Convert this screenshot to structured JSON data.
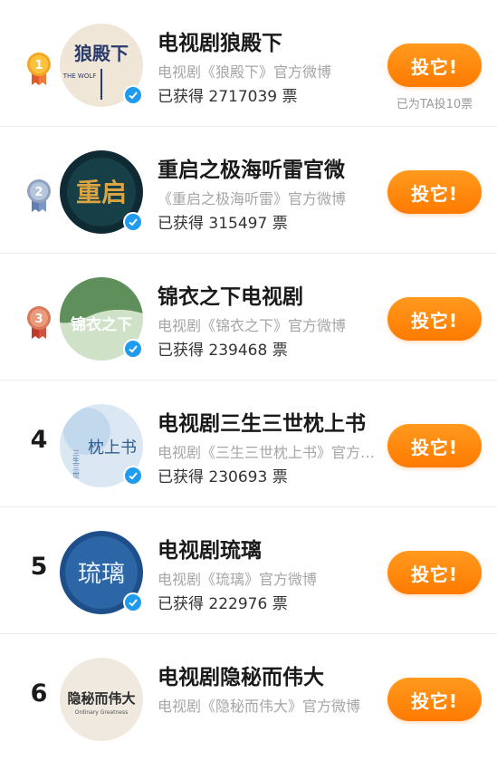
{
  "button_label": "投它!",
  "colors": {
    "accent": "#ff8a00",
    "verified": "#1f9bf0",
    "gold": "#f5a623",
    "silver": "#8fa3c0",
    "bronze": "#d9785a"
  },
  "items": [
    {
      "rank": "1",
      "medal": "gold",
      "name": "电视剧狼殿下",
      "desc": "电视剧《狼殿下》官方微博",
      "votes": "已获得 2717039 票",
      "voted_note": "已为TA投10票",
      "avatar_text": "狼殿下",
      "avatar_sub": "THE WOLF"
    },
    {
      "rank": "2",
      "medal": "silver",
      "name": "重启之极海听雷官微",
      "desc": "《重启之极海听雷》官方微博",
      "votes": "已获得 315497 票",
      "avatar_text": "重启"
    },
    {
      "rank": "3",
      "medal": "bronze",
      "name": "锦衣之下电视剧",
      "desc": "电视剧《锦衣之下》官方微博",
      "votes": "已获得 239468 票",
      "avatar_text": "锦衣之下"
    },
    {
      "rank": "4",
      "name": "电视剧三生三世枕上书",
      "desc": "电视剧《三生三世枕上书》官方微博",
      "votes": "已获得 230693 票",
      "avatar_text": "枕上书",
      "avatar_sub": "三生三世"
    },
    {
      "rank": "5",
      "name": "电视剧琉璃",
      "desc": "电视剧《琉璃》官方微博",
      "votes": "已获得 222976 票",
      "avatar_text": "琉璃"
    },
    {
      "rank": "6",
      "name": "电视剧隐秘而伟大",
      "desc": "电视剧《隐秘而伟大》官方微博",
      "votes": "",
      "avatar_text": "隐秘而伟大",
      "avatar_sub": "Ordinary Greatness"
    }
  ]
}
